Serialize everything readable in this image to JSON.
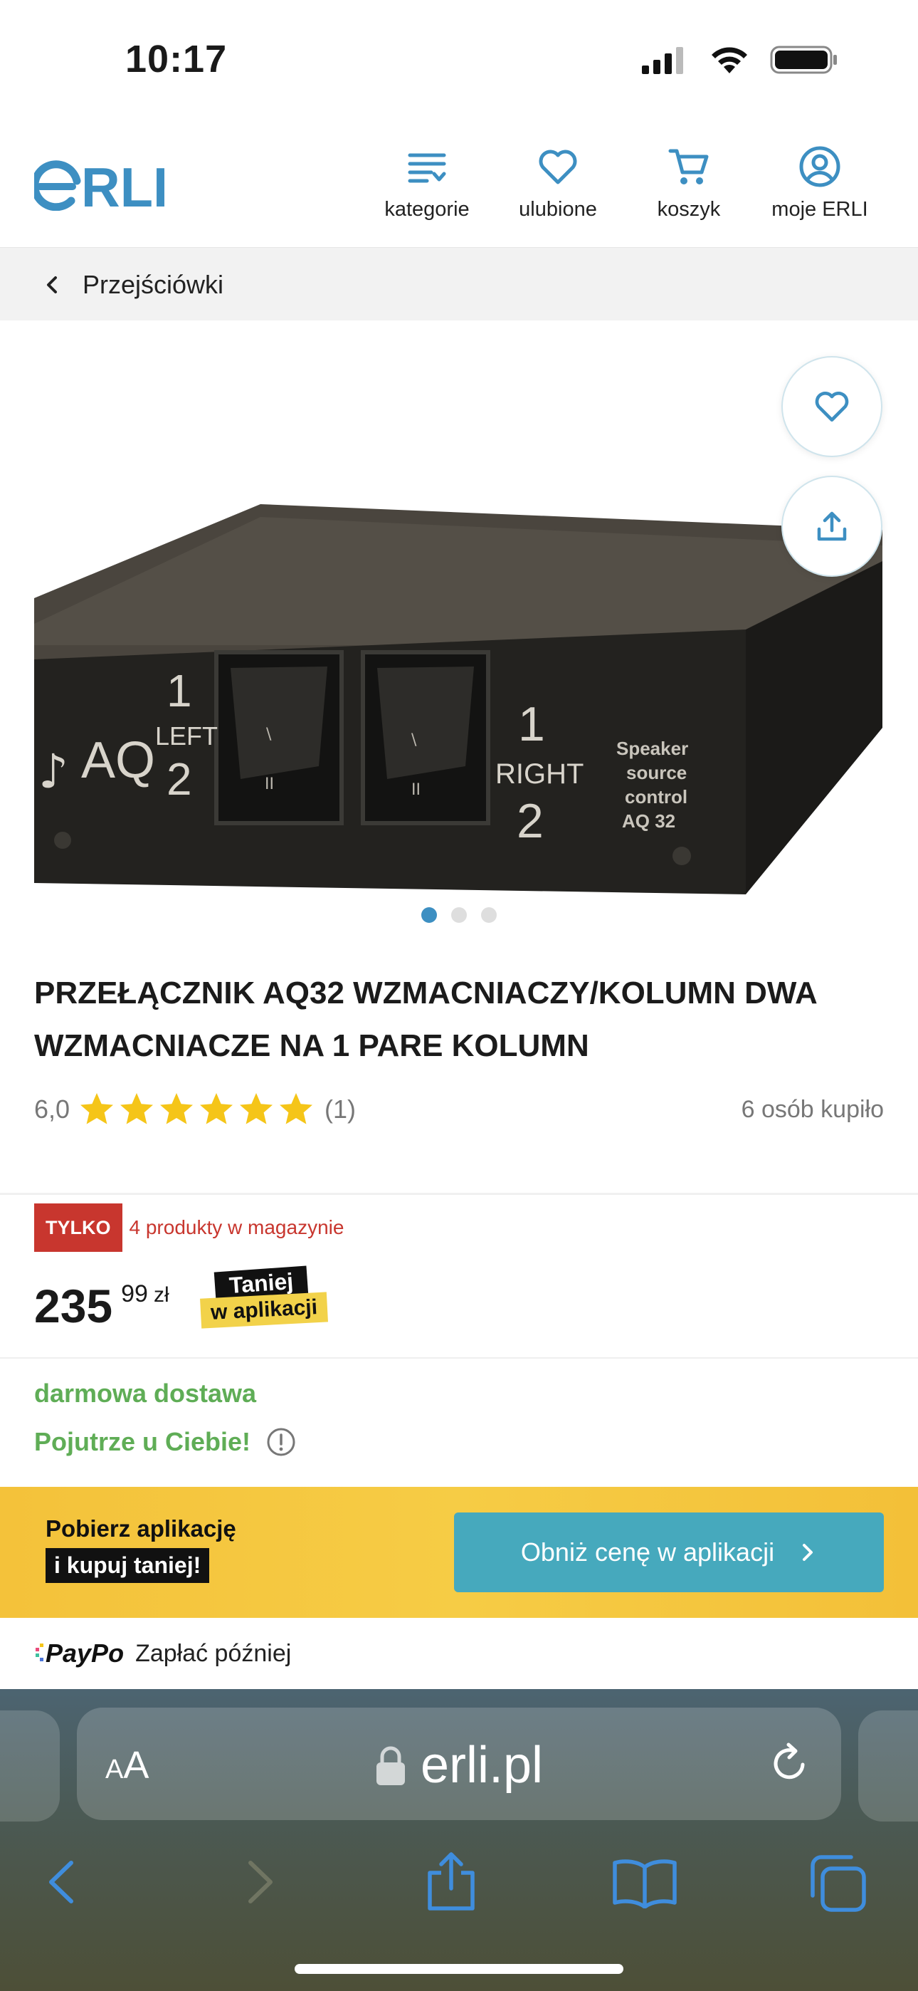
{
  "status_bar": {
    "time": "10:17"
  },
  "header": {
    "logo": "ERLI",
    "nav": [
      {
        "label": "kategorie",
        "icon": "categories-icon"
      },
      {
        "label": "ulubione",
        "icon": "heart-icon"
      },
      {
        "label": "koszyk",
        "icon": "cart-icon"
      },
      {
        "label": "moje ERLI",
        "icon": "user-icon"
      }
    ]
  },
  "breadcrumb": {
    "label": "Przejściówki"
  },
  "product": {
    "image_dots": 3,
    "title": "PRZEŁĄCZNIK AQ32 WZMACNIACZY/KOLUMN DWA WZMACNIACZE NA 1 PARE KOLUMN",
    "rating_score": "6,0",
    "rating_stars": 6,
    "rating_count": "(1)",
    "buyers": "6 osób kupiło",
    "image_text": {
      "aq": "AQ",
      "left_1": "1",
      "left_label": "LEFT",
      "left_2": "2",
      "right_1": "1",
      "right_label": "RIGHT",
      "right_2": "2",
      "side_line1": "Speaker",
      "side_line2": "source",
      "side_line3": "control",
      "side_line4": "AQ 32"
    }
  },
  "stock": {
    "badge": "TYLKO",
    "text": "4 produkty w magazynie"
  },
  "price": {
    "main": "235",
    "cents": "99",
    "currency": "zł",
    "tag_top": "Taniej",
    "tag_bottom": "w aplikacji"
  },
  "delivery": {
    "free": "darmowa dostawa",
    "eta": "Pojutrze u Ciebie!"
  },
  "app_banner": {
    "line1": "Pobierz aplikację",
    "line2": "i kupuj taniej!",
    "button": "Obniż cenę w aplikacji"
  },
  "paypo": {
    "logo": "PayPo",
    "text": "Zapłać później"
  },
  "browser": {
    "aa_small": "A",
    "aa_big": "A",
    "url": "erli.pl"
  },
  "colors": {
    "brand": "#3d8fc2",
    "star": "#f5c518",
    "green": "#5fad56",
    "red": "#c8362e",
    "banner_btn": "#46a9bd"
  }
}
